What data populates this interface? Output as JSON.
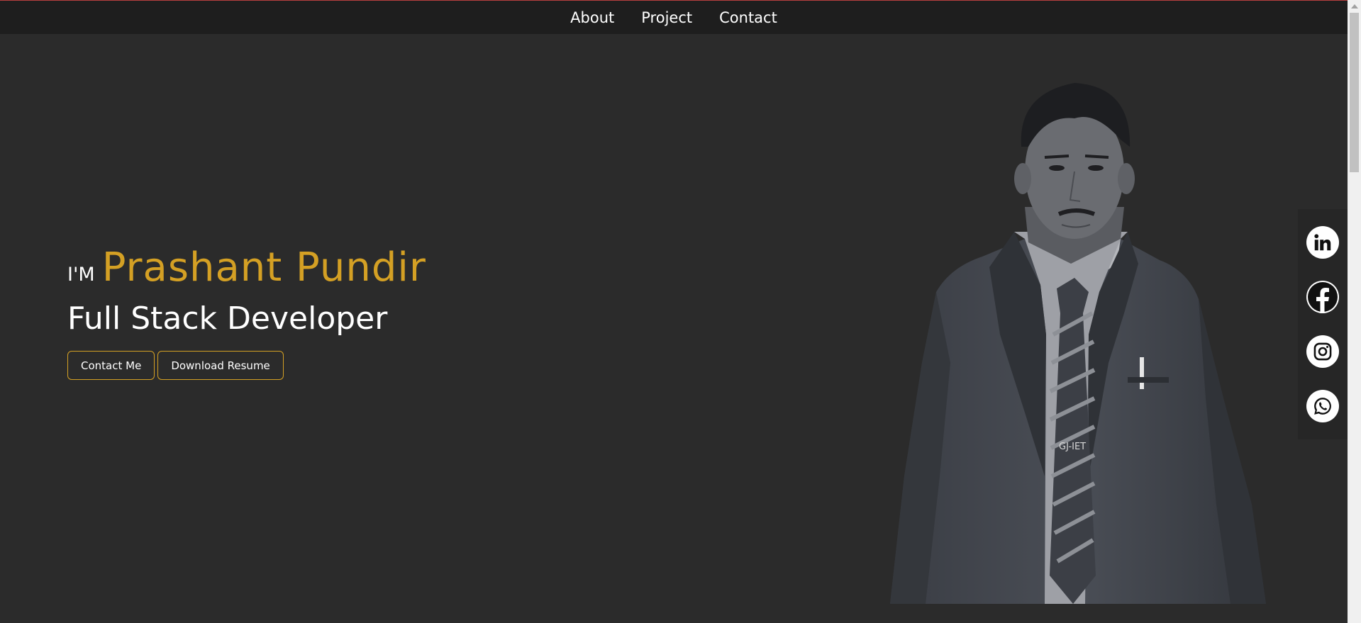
{
  "nav": {
    "links": [
      {
        "label": "About"
      },
      {
        "label": "Project"
      },
      {
        "label": "Contact"
      }
    ]
  },
  "hero": {
    "prefix": "I'M",
    "name": "Prashant Pundir",
    "role": "Full Stack Developer",
    "buttons": {
      "contact": "Contact Me",
      "resume": "Download Resume"
    },
    "tie_text": "GJ-IET"
  },
  "social": [
    {
      "icon": "linkedin-icon"
    },
    {
      "icon": "facebook-icon"
    },
    {
      "icon": "instagram-icon"
    },
    {
      "icon": "whatsapp-icon"
    }
  ],
  "colors": {
    "background": "#2b2b2b",
    "navbar": "#1e1e1e",
    "accent": "#d4a024",
    "text": "#ffffff"
  }
}
